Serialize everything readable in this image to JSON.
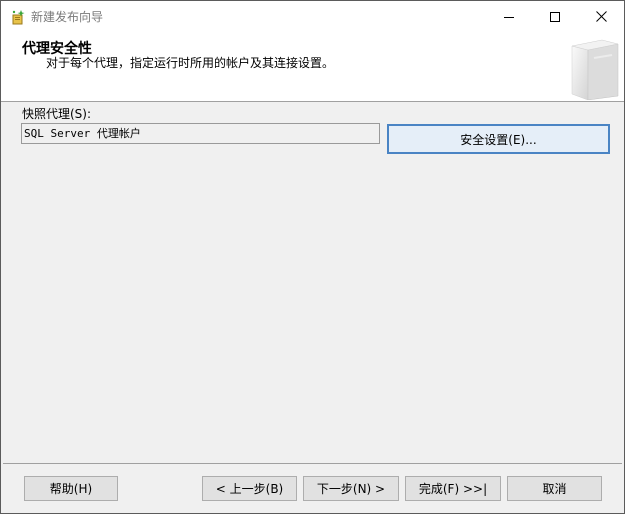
{
  "window": {
    "title": "新建发布向导"
  },
  "header": {
    "title": "代理安全性",
    "subtitle": "对于每个代理，指定运行时所用的帐户及其连接设置。"
  },
  "snapshot_agent": {
    "label": "快照代理(S):",
    "value": "SQL Server 代理帐户",
    "security_button": "安全设置(E)..."
  },
  "footer": {
    "help": "帮助(H)",
    "back": "< 上一步(B)",
    "next": "下一步(N) >",
    "finish": "完成(F) >>|",
    "cancel": "取消"
  },
  "colors": {
    "accent_border": "#4a84c4",
    "title_text": "#7a7a7a",
    "dialog_bg": "#f0f0f0"
  }
}
